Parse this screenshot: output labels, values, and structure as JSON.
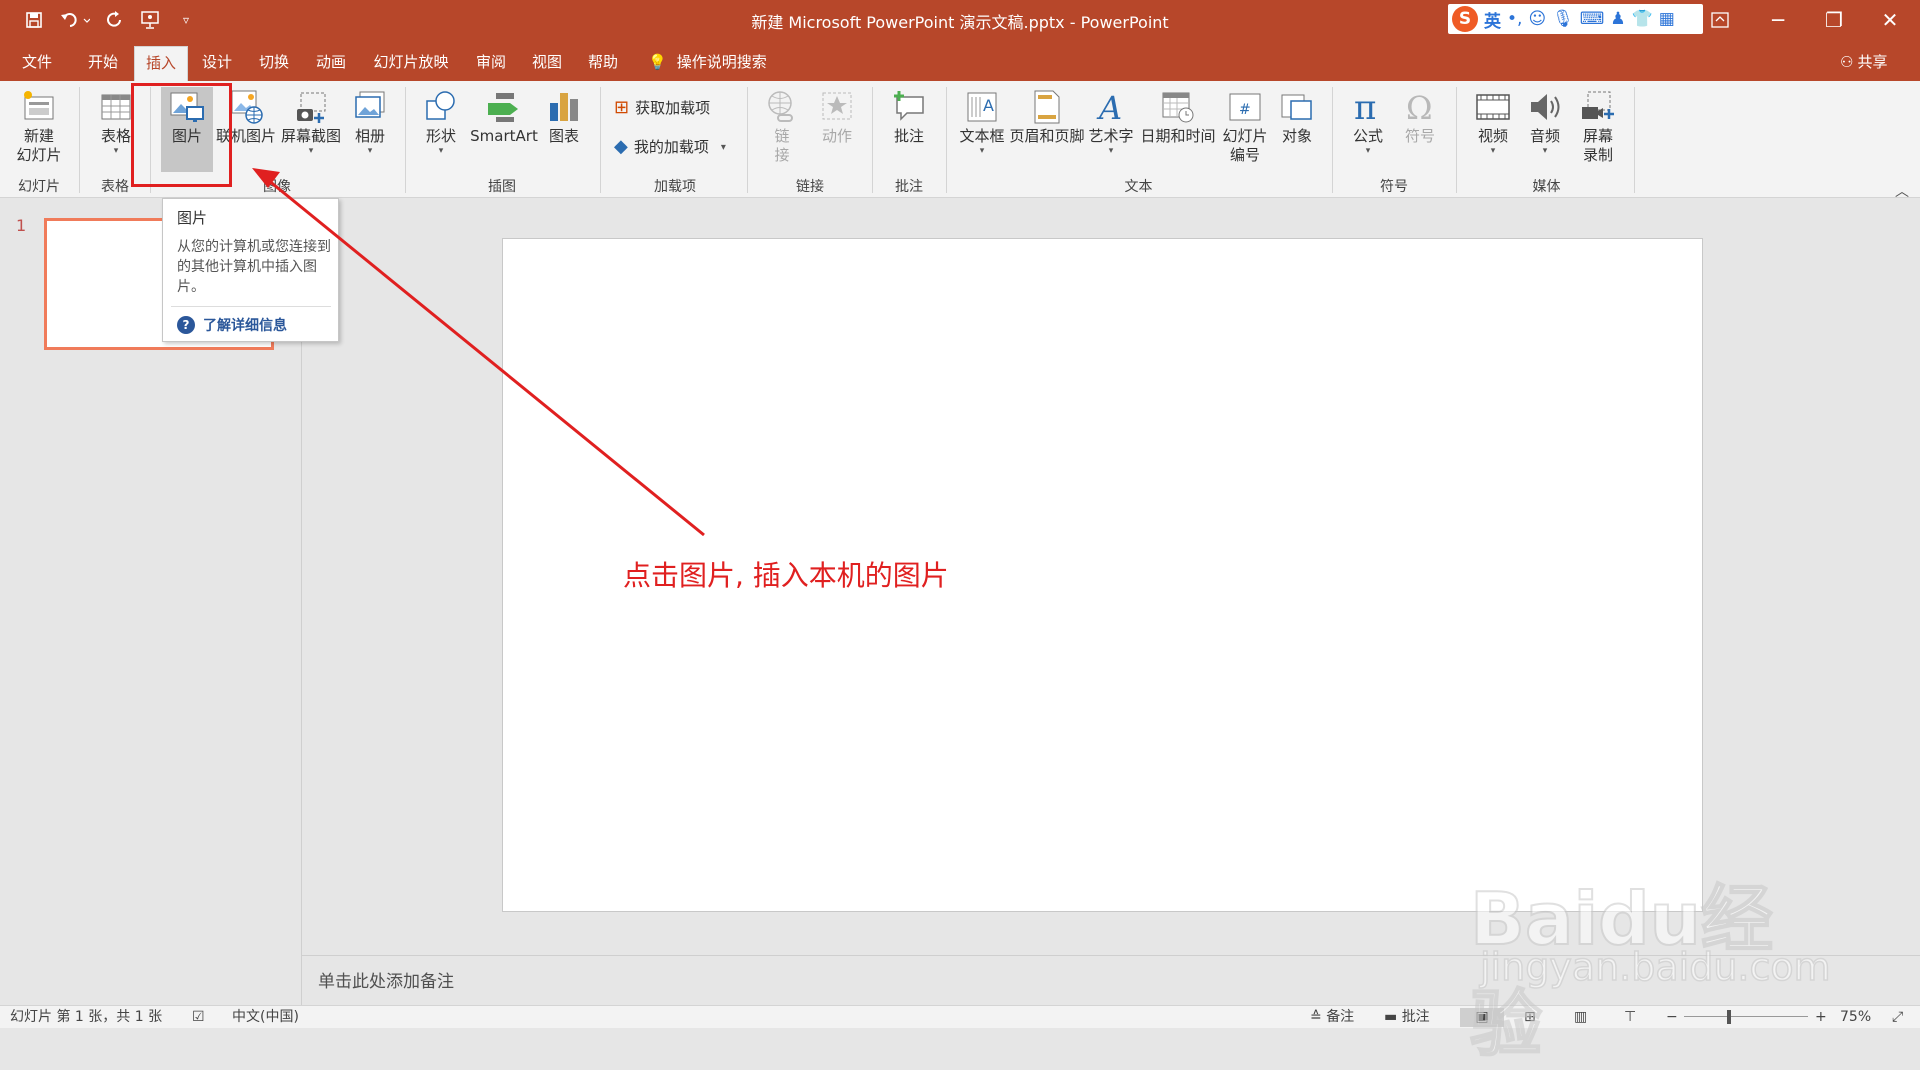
{
  "title": "新建 Microsoft PowerPoint 演示文稿.pptx  -  PowerPoint",
  "qat": {
    "icons": [
      "save-icon",
      "undo-icon",
      "redo-icon",
      "presenter-icon",
      "customize-icon"
    ]
  },
  "window": {
    "minimize": "─",
    "restore": "❐",
    "close": "✕"
  },
  "ime": {
    "logo": "S",
    "lang": "英",
    "punct": "•,"
  },
  "tabs": [
    "文件",
    "开始",
    "插入",
    "设计",
    "切换",
    "动画",
    "幻灯片放映",
    "审阅",
    "视图",
    "帮助"
  ],
  "active_tab": "插入",
  "tell_me": "操作说明搜索",
  "share": "共享",
  "ribbon": {
    "new_slide": [
      "新建",
      "幻灯片"
    ],
    "table": "表格",
    "pictures": "图片",
    "online_pictures": "联机图片",
    "screenshot": "屏幕截图",
    "album": "相册",
    "shapes": "形状",
    "smartart": "SmartArt",
    "chart": "图表",
    "get_addins": "获取加载项",
    "my_addins": "我的加载项",
    "link": [
      "链",
      "接"
    ],
    "action": "动作",
    "comment": "批注",
    "textbox": "文本框",
    "header_footer": "页眉和页脚",
    "wordart": "艺术字",
    "datetime": "日期和时间",
    "slide_number": [
      "幻灯片",
      "编号"
    ],
    "object": "对象",
    "equation": "公式",
    "symbol": "符号",
    "video": "视频",
    "audio": "音频",
    "screen_record": [
      "屏幕",
      "录制"
    ],
    "groups": {
      "slides": "幻灯片",
      "tables": "表格",
      "images": "图像",
      "illustrations": "插图",
      "addins": "加载项",
      "links": "链接",
      "comments": "批注",
      "text": "文本",
      "symbols": "符号",
      "media": "媒体"
    }
  },
  "slide_number": "1",
  "tooltip": {
    "title": "图片",
    "desc": "从您的计算机或您连接到的其他计算机中插入图片。",
    "more": "了解详细信息"
  },
  "annotation": "点击图片, 插入本机的图片",
  "notes_placeholder": "单击此处添加备注",
  "status": {
    "slide_info": "幻灯片 第 1 张，共 1 张",
    "lang": "中文(中国)",
    "notes": "备注",
    "comments": "批注",
    "zoom": "75%"
  },
  "watermark": {
    "logo": "Baidu经验",
    "url": "jingyan.baidu.com"
  }
}
